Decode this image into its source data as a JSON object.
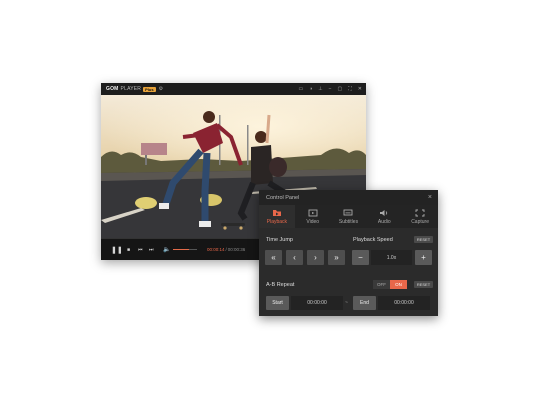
{
  "player": {
    "brand": "GOM",
    "brand_sub": "PLAYER",
    "plus_badge": "Plus",
    "title_icons": [
      "cc-icon",
      "vr-icon",
      "pin-icon",
      "minimize-icon",
      "restore-icon",
      "fullscreen-icon",
      "close-icon"
    ],
    "time_current": "00:00:14",
    "time_separator": "/",
    "time_total": "00:00:36",
    "volume_level": 0.65,
    "progress": 0.39
  },
  "control_panel": {
    "title": "Control Panel",
    "tabs": [
      {
        "label": "Playback",
        "icon": "playback-icon",
        "active": true
      },
      {
        "label": "Video",
        "icon": "video-icon",
        "active": false
      },
      {
        "label": "Subtitles",
        "icon": "subtitles-icon",
        "active": false
      },
      {
        "label": "Audio",
        "icon": "audio-icon",
        "active": false
      },
      {
        "label": "Capture",
        "icon": "capture-icon",
        "active": false
      }
    ],
    "time_jump_label": "Time Jump",
    "playback_speed_label": "Playback Speed",
    "reset_label": "RESET",
    "speed_value": "1.0x",
    "ab_repeat_label": "A-B Repeat",
    "toggle_off": "OFF",
    "toggle_on": "ON",
    "ab_reset_label": "RESET",
    "start_label": "Start",
    "start_time": "00:00:00",
    "end_label": "End",
    "end_time": "00:00:00",
    "range_separator": "~"
  },
  "colors": {
    "accent": "#e8674a",
    "panel_bg": "#2b2b2b",
    "player_bg": "#111111"
  }
}
